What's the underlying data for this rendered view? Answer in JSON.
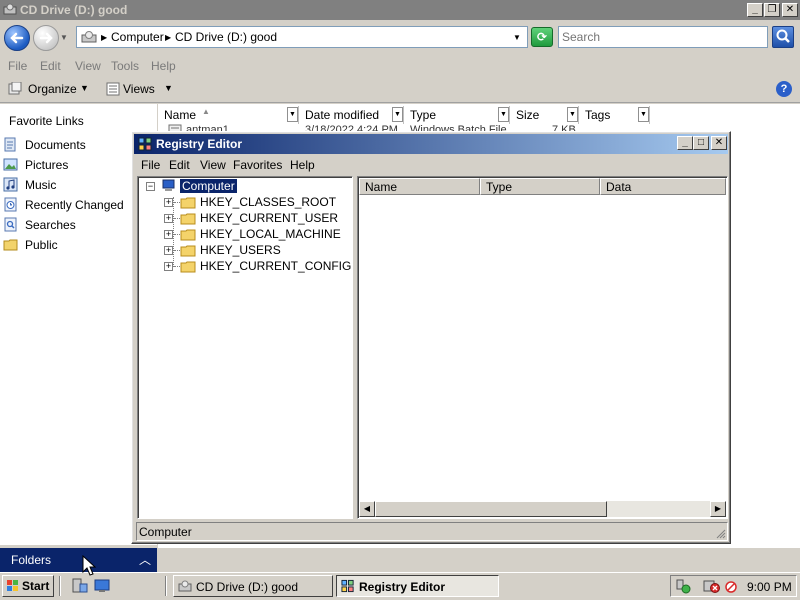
{
  "explorer": {
    "title": "CD Drive (D:) good",
    "address": [
      "Computer",
      "CD Drive (D:) good"
    ],
    "search_placeholder": "Search",
    "menu": [
      "File",
      "Edit",
      "View",
      "Tools",
      "Help"
    ],
    "commands": {
      "organize": "Organize",
      "views": "Views"
    },
    "nav": {
      "header": "Favorite Links",
      "items": [
        "Documents",
        "Pictures",
        "Music",
        "Recently Changed",
        "Searches",
        "Public"
      ],
      "folders_label": "Folders"
    },
    "columns": [
      "Name",
      "Date modified",
      "Type",
      "Size",
      "Tags"
    ],
    "file_row": {
      "name": "antman1",
      "date": "3/18/2022 4:24 PM",
      "type": "Windows Batch File",
      "size": "7 KB"
    }
  },
  "regedit": {
    "title": "Registry Editor",
    "menu": [
      "File",
      "Edit",
      "View",
      "Favorites",
      "Help"
    ],
    "tree": {
      "root": "Computer",
      "hives": [
        "HKEY_CLASSES_ROOT",
        "HKEY_CURRENT_USER",
        "HKEY_LOCAL_MACHINE",
        "HKEY_USERS",
        "HKEY_CURRENT_CONFIG"
      ]
    },
    "list_columns": [
      "Name",
      "Type",
      "Data"
    ],
    "status": "Computer"
  },
  "taskbar": {
    "start_label": "Start",
    "tasks": [
      "CD Drive (D:) good",
      "Registry Editor"
    ],
    "clock": "9:00 PM"
  },
  "colors": {
    "title_active": "#0a246a",
    "title_active_end": "#a6caf0",
    "title_inactive": "#808080",
    "face": "#d4d0c8",
    "selection": "#0a246a"
  }
}
